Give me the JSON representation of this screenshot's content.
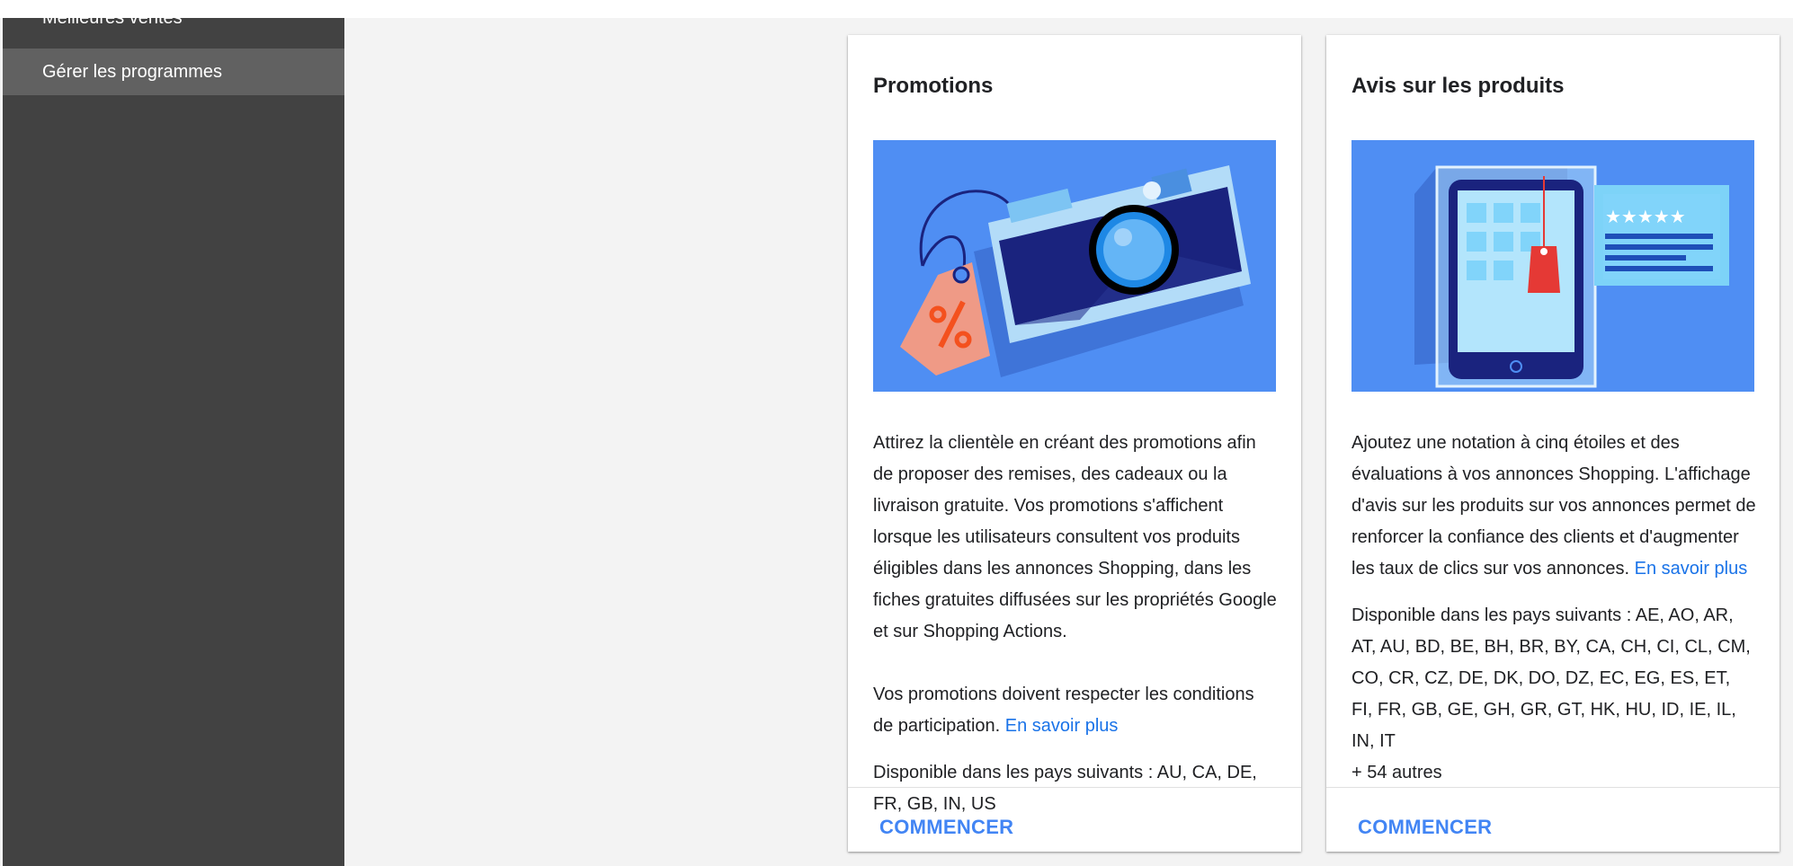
{
  "sidebar": {
    "items": [
      {
        "label": "Meilleures ventes"
      },
      {
        "label": "Gérer les programmes"
      }
    ]
  },
  "cards": [
    {
      "title": "Promotions",
      "paragraphs": [
        "Attirez la clientèle en créant des promotions afin de proposer des remises, des cadeaux ou la livraison gratuite. Vos promotions s'affichent lorsque les utilisateurs consultent vos produits éligibles dans les annonces Shopping, dans les fiches gratuites diffusées sur les propriétés Google et sur Shopping Actions.",
        "Vos promotions doivent respecter les conditions de participation."
      ],
      "learn_more": "En savoir plus",
      "availability": "Disponible dans les pays suivants : AU, CA, DE, FR, GB, IN, US",
      "button": "COMMENCER"
    },
    {
      "title": "Avis sur les produits",
      "paragraphs": [
        "Ajoutez une notation à cinq étoiles et des évaluations à vos annonces Shopping. L'affichage d'avis sur les produits sur vos annonces permet de renforcer la confiance des clients et d'augmenter les taux de clics sur vos annonces."
      ],
      "learn_more": "En savoir plus",
      "availability": "Disponible dans les pays suivants : AE, AO, AR, AT, AU, BD, BE, BH, BR, BY, CA, CH, CI, CL, CM, CO, CR, CZ, DE, DK, DO, DZ, EC, EG, ES, ET, FI, FR, GB, GE, GH, GR, GT, HK, HU, ID, IE, IL, IN, IT",
      "more_countries": "+ 54 autres",
      "button": "COMMENCER"
    }
  ],
  "illustrations": {
    "promotions": "camera-with-price-tag-illustration",
    "reviews": "tablet-with-star-rating-illustration",
    "rating_stars": 5
  },
  "colors": {
    "sidebar_bg": "#424242",
    "sidebar_active": "#616161",
    "content_bg": "#f3f3f3",
    "link": "#1a73e8",
    "button": "#4285f4",
    "illustration_bg": "#4f8ef3"
  }
}
